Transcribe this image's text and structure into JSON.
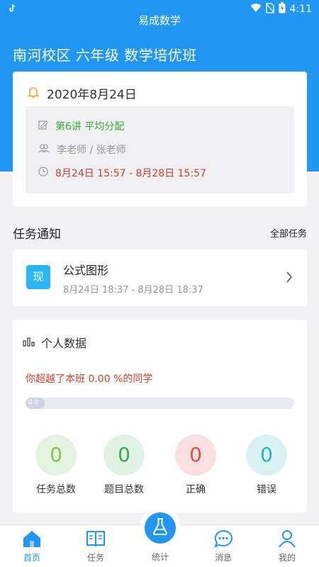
{
  "status_bar": {
    "time": "4:11",
    "notification_icon": "tiktok-icon"
  },
  "app": {
    "title": "易成数学"
  },
  "class_title": "南河校区 六年级 数学培优班",
  "lesson": {
    "date": "2020年8月24日",
    "name": "第6讲 平均分配",
    "teachers": "李老师 / 张老师",
    "time_range": "8月24日 15:57 - 8月28日 15:57"
  },
  "tasks_section": {
    "title": "任务通知",
    "all_tasks_label": "全部任务"
  },
  "task": {
    "badge": "现",
    "name": "公式图形",
    "time_range": "8月24日 18:37 - 8月28日 18:37"
  },
  "personal_data": {
    "title": "个人数据",
    "beat_text": "你超越了本班 0.00 %的同学",
    "progress_fraction": 0.07,
    "progress_label": "0.0",
    "stats": [
      {
        "label": "任务总数",
        "value": "0",
        "color": "#8bc34a"
      },
      {
        "label": "题目总数",
        "value": "0",
        "color": "#3aaa5a"
      },
      {
        "label": "正确",
        "value": "0",
        "color": "#e0534a"
      },
      {
        "label": "错误",
        "value": "0",
        "color": "#26b4c0"
      }
    ]
  },
  "bottom_nav": {
    "home": "首页",
    "tasks": "任务",
    "stats": "统计",
    "messages": "消息",
    "mine": "我的"
  },
  "colors": {
    "primary": "#2196f3",
    "green": "#3aaa3a",
    "red": "#d0402a"
  }
}
